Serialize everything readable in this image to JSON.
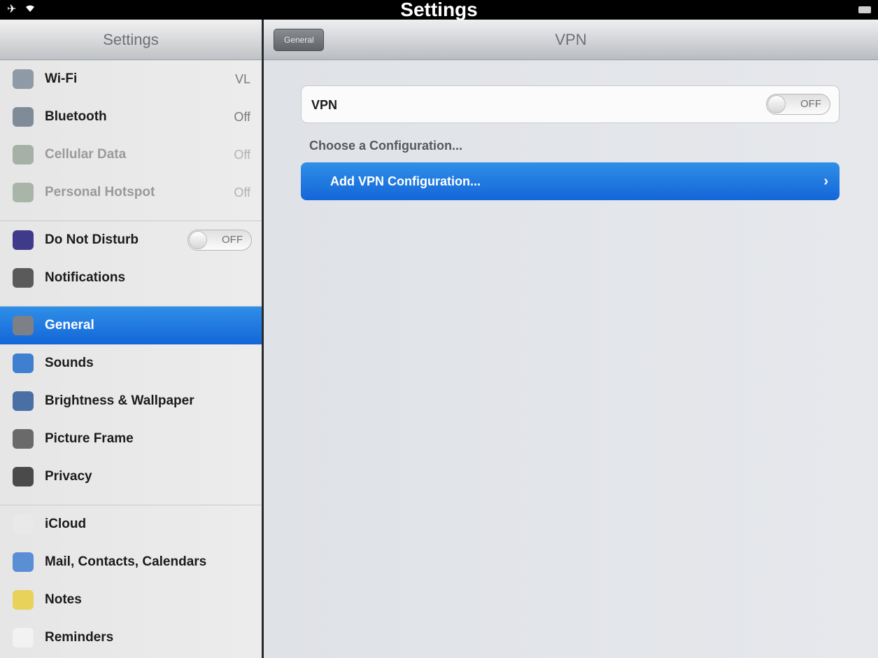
{
  "status_bar": {
    "title": "Settings",
    "airplane_icon": "airplane-icon",
    "wifi_icon": "wifi-icon",
    "battery_icon": "battery-icon"
  },
  "sidebar": {
    "title": "Settings",
    "groups": [
      [
        {
          "label": "Wi-Fi",
          "value": "VL",
          "icon": "wifi-icon",
          "color": "#8e9aa6",
          "dim": false
        },
        {
          "label": "Bluetooth",
          "value": "Off",
          "icon": "bluetooth-icon",
          "color": "#7f8b98",
          "dim": false
        },
        {
          "label": "Cellular Data",
          "value": "Off",
          "icon": "cellular-icon",
          "color": "#a5b1a5",
          "dim": true
        },
        {
          "label": "Personal Hotspot",
          "value": "Off",
          "icon": "hotspot-icon",
          "color": "#a9b5a9",
          "dim": true
        }
      ],
      [
        {
          "label": "Do Not Disturb",
          "toggle": "OFF",
          "icon": "moon-icon",
          "color": "#3f3a8a",
          "dim": false
        },
        {
          "label": "Notifications",
          "icon": "notifications-icon",
          "color": "#5a5a5a",
          "dim": false
        }
      ],
      [
        {
          "label": "General",
          "icon": "gear-icon",
          "color": "#7d8087",
          "dim": false,
          "selected": true
        },
        {
          "label": "Sounds",
          "icon": "speaker-icon",
          "color": "#3f7fcf",
          "dim": false
        },
        {
          "label": "Brightness & Wallpaper",
          "icon": "brightness-icon",
          "color": "#4a6fa5",
          "dim": false
        },
        {
          "label": "Picture Frame",
          "icon": "picture-frame-icon",
          "color": "#6a6a6a",
          "dim": false
        },
        {
          "label": "Privacy",
          "icon": "hand-icon",
          "color": "#4a4a4a",
          "dim": false
        }
      ],
      [
        {
          "label": "iCloud",
          "icon": "cloud-icon",
          "color": "#e9e9e9",
          "dim": false
        },
        {
          "label": "Mail, Contacts, Calendars",
          "icon": "mail-icon",
          "color": "#5a8fd6",
          "dim": false
        },
        {
          "label": "Notes",
          "icon": "notes-icon",
          "color": "#e9d25a",
          "dim": false
        },
        {
          "label": "Reminders",
          "icon": "reminders-icon",
          "color": "#f2f2f2",
          "dim": false
        }
      ]
    ]
  },
  "detail": {
    "back_label": "General",
    "title": "VPN",
    "vpn_label": "VPN",
    "vpn_toggle": "OFF",
    "section_label": "Choose a Configuration...",
    "add_label": "Add VPN Configuration...",
    "add_chevron": "›"
  },
  "colors": {
    "selected_blue": "#1f7ae0",
    "sidebar_bg": "#e8e8e8",
    "detail_bg": "#e2e5e9"
  }
}
